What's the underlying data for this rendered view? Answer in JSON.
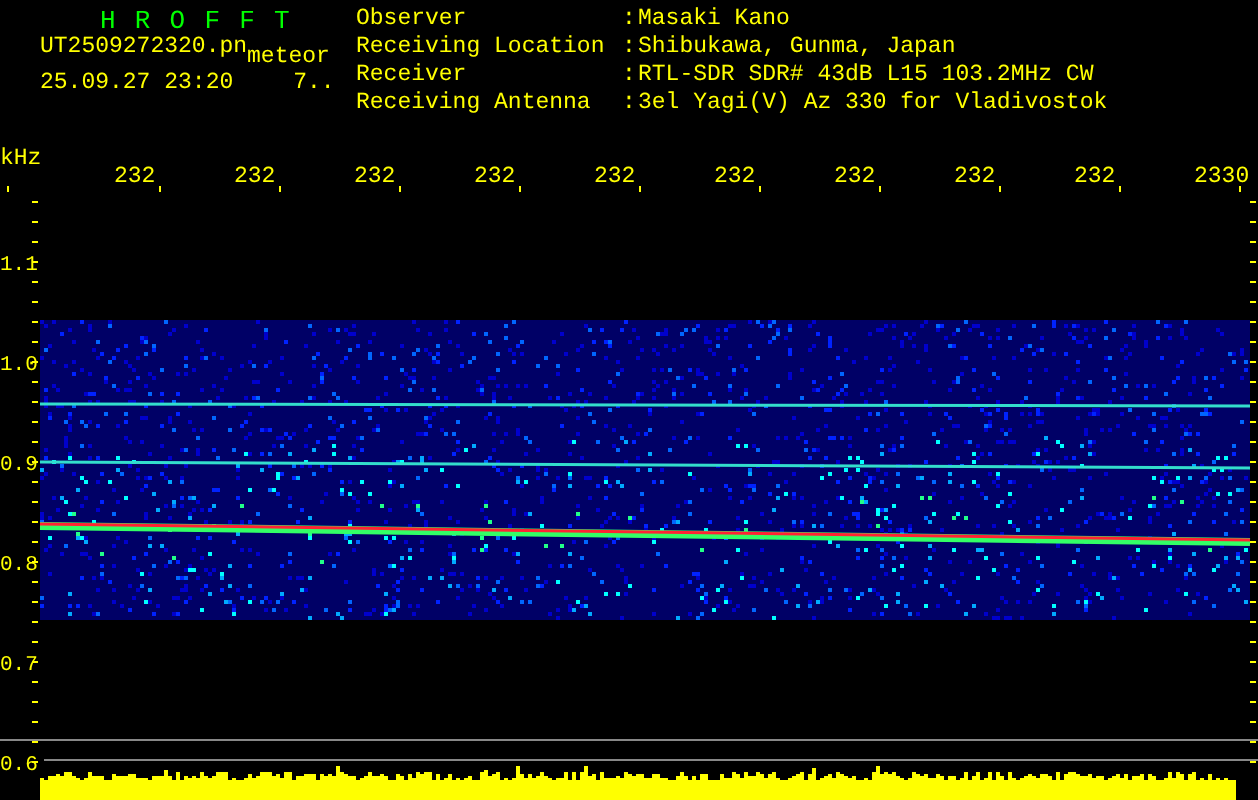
{
  "app_title": "HROFFT",
  "file_name": "UT2509272320.pn",
  "mode": "meteor",
  "timestamp": "25.09.27 23:20",
  "count": "7..",
  "info": [
    {
      "label": "Observer",
      "separator": ":",
      "value": "Masaki Kano"
    },
    {
      "label": "Receiving Location",
      "separator": ":",
      "value": "Shibukawa, Gunma, Japan"
    },
    {
      "label": "Receiver",
      "separator": ":",
      "value": "RTL-SDR SDR# 43dB L15 103.2MHz CW"
    },
    {
      "label": "Receiving Antenna",
      "separator": ":",
      "value": "3el Yagi(V) Az 330 for Vladivostok"
    }
  ],
  "frequency_axis": {
    "unit": "kHz",
    "labels": [
      "232",
      "232",
      "232",
      "232",
      "232",
      "232",
      "232",
      "232",
      "232",
      "2330"
    ]
  },
  "offset_axis": {
    "labels": [
      "1.1",
      "1.0",
      "0.9",
      "0.8",
      "0.7",
      "0.6"
    ]
  }
}
